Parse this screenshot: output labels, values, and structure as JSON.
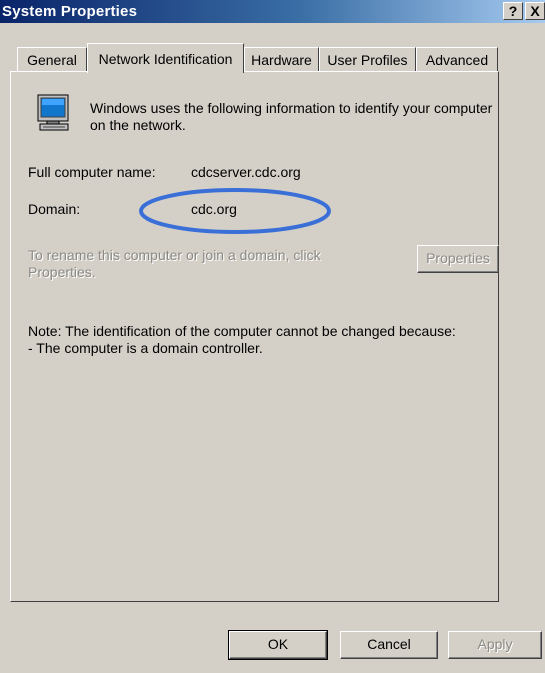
{
  "window": {
    "title": "System Properties",
    "help_label": "?",
    "close_label": "X"
  },
  "tabs": [
    {
      "label": "General",
      "active": false
    },
    {
      "label": "Network Identification",
      "active": true
    },
    {
      "label": "Hardware",
      "active": false
    },
    {
      "label": "User Profiles",
      "active": false
    },
    {
      "label": "Advanced",
      "active": false
    }
  ],
  "panel": {
    "intro_line1": "Windows uses the following information to identify your computer",
    "intro_line2": "on the network.",
    "full_name_label": "Full computer name:",
    "full_name_value": "cdcserver.cdc.org",
    "domain_label": "Domain:",
    "domain_value": "cdc.org",
    "rename_line1": "To rename this computer or join a domain, click",
    "rename_line2": "Properties.",
    "properties_button": "Properties",
    "note_line1": "Note: The identification of the computer cannot be changed because:",
    "note_line2": "- The computer is a domain controller."
  },
  "buttons": {
    "ok": "OK",
    "cancel": "Cancel",
    "apply": "Apply"
  },
  "colors": {
    "titlebar": "#0a246a",
    "dialog": "#d4d0c8",
    "annotation_ellipse": "#3a6fd8"
  },
  "icons": {
    "computer": "computer-monitor-icon"
  }
}
